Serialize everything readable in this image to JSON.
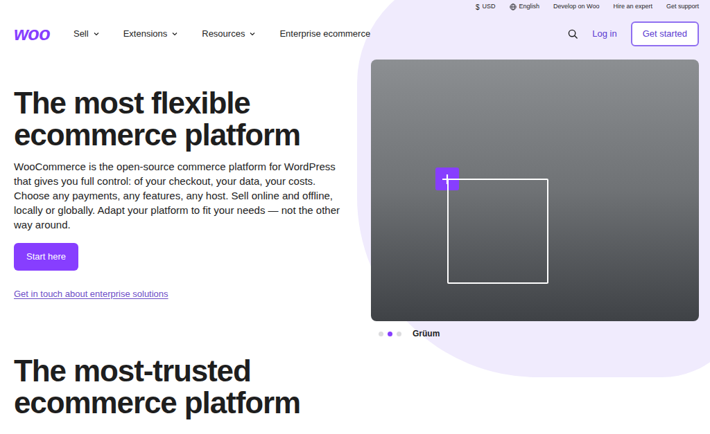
{
  "topbar": {
    "currency_symbol": "$",
    "currency": "USD",
    "language": "English",
    "links": [
      "Develop on Woo",
      "Hire an expert",
      "Get support"
    ]
  },
  "nav": {
    "logo": "woo",
    "items": [
      {
        "label": "Sell",
        "has_menu": true
      },
      {
        "label": "Extensions",
        "has_menu": true
      },
      {
        "label": "Resources",
        "has_menu": true
      },
      {
        "label": "Enterprise ecommerce",
        "has_menu": false
      }
    ],
    "login": "Log in",
    "cta": "Get started"
  },
  "hero": {
    "title": "The most flexible ecommerce platform",
    "description": "WooCommerce is the open-source commerce platform for WordPress that gives you full control: of your checkout, your data, your costs. Choose any payments, any features, any host. Sell online and offline, locally or globally. Adapt your platform to fit your needs — not the other way around.",
    "primary_button": "Start here",
    "link": "Get in touch about enterprise solutions"
  },
  "carousel": {
    "slides": [
      {
        "selected": false
      },
      {
        "selected": true
      },
      {
        "selected": false
      }
    ],
    "caption": "Grüum"
  },
  "section": {
    "title": "The most-trusted ecommerce platform"
  }
}
